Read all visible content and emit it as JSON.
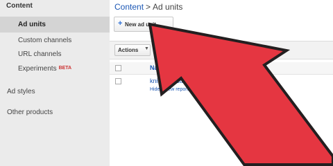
{
  "sidebar": {
    "heading": "Content",
    "items": [
      {
        "label": "Ad units",
        "selected": true
      },
      {
        "label": "Custom channels"
      },
      {
        "label": "URL channels"
      },
      {
        "label": "Experiments",
        "badge": "BETA"
      }
    ],
    "sections": [
      "Ad styles",
      "Other products"
    ]
  },
  "breadcrumb": {
    "root": "Content",
    "separator": ">",
    "current": "Ad units"
  },
  "toolbar": {
    "new_button": "New ad unit",
    "actions_button": "Actions"
  },
  "table": {
    "column_name": "Name",
    "sort_indicator": "↑",
    "rows": [
      {
        "name": "knits and stitches",
        "links": [
          "Hide",
          "View report"
        ]
      }
    ]
  },
  "overlay": {
    "arrow_color": "#e53641",
    "arrow_outline": "#231f20"
  },
  "colors": {
    "link": "#1a56b4",
    "beta": "#cc3333",
    "sidebar_bg": "#ebebeb"
  }
}
